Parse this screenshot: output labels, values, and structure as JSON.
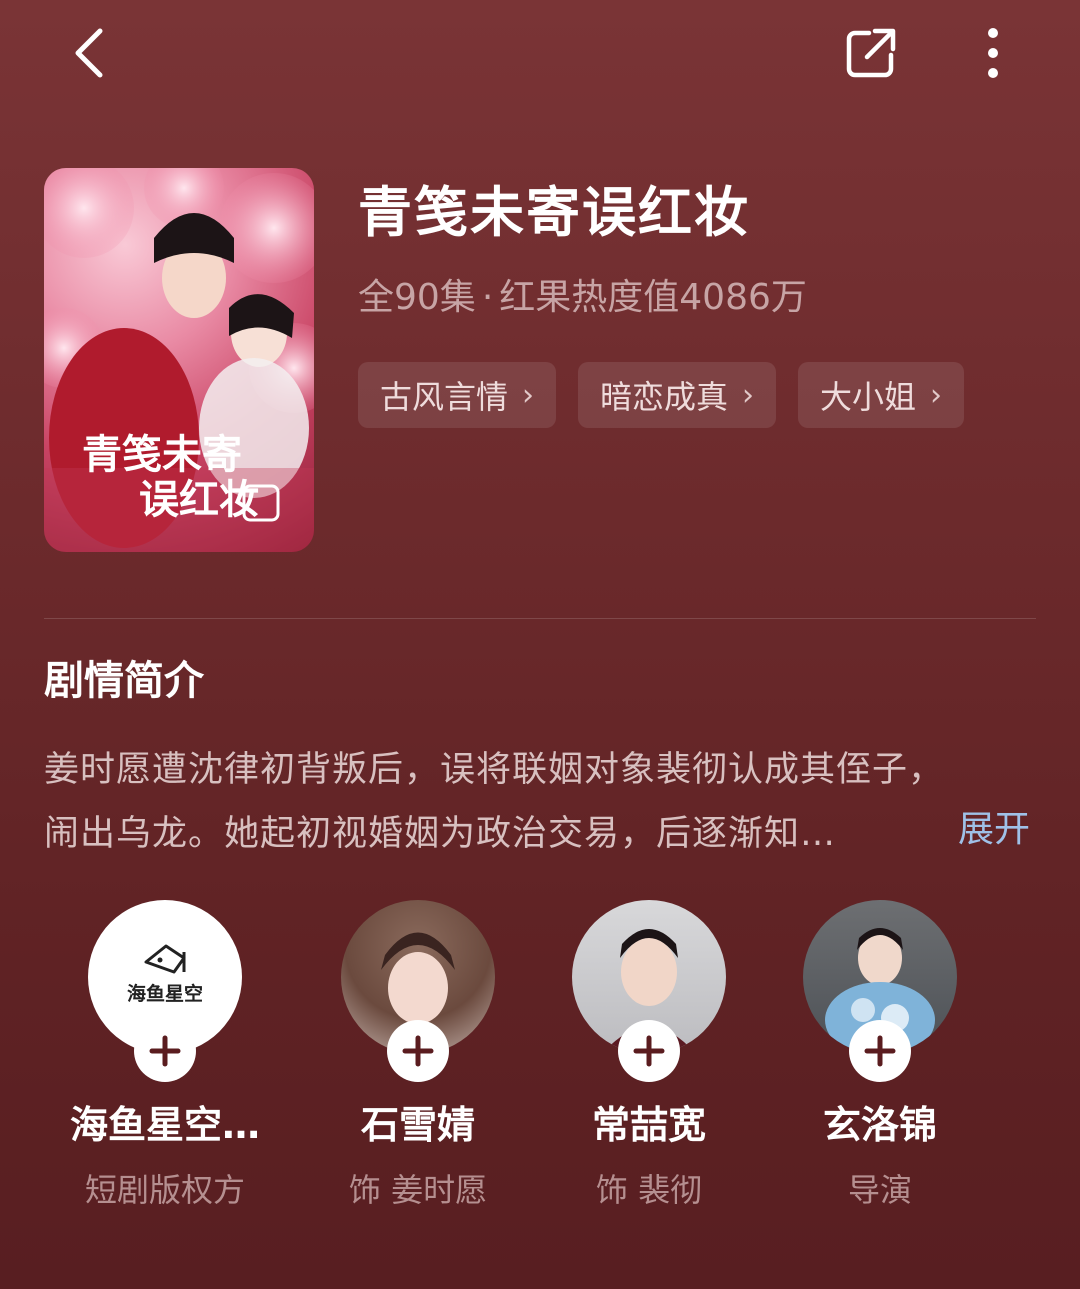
{
  "header": {
    "back_icon": "back-arrow-icon",
    "share_icon": "share-icon",
    "more_icon": "more-vertical-icon"
  },
  "drama": {
    "title": "青笺未寄误红妆",
    "episodes": "全90集",
    "separator": "·",
    "heat": "红果热度值4086万",
    "poster_title_lines": [
      "青笺未寄",
      "误红妆"
    ],
    "tags": [
      "古风言情",
      "暗恋成真",
      "大小姐"
    ]
  },
  "synopsis": {
    "heading": "剧情简介",
    "line1": "姜时愿遭沈律初背叛后，误将联姻对象裴彻认成其侄子，",
    "line2": "闹出乌龙。她起初视婚姻为政治交易，后逐渐知…",
    "expand_label": "展开"
  },
  "cast": [
    {
      "name": "海鱼星空…",
      "role": "短剧版权方",
      "logo_text": "海鱼星空"
    },
    {
      "name": "石雪婧",
      "role": "饰 姜时愿"
    },
    {
      "name": "常喆宽",
      "role": "饰 裴彻"
    },
    {
      "name": "玄洛锦",
      "role": "导演"
    }
  ],
  "colors": {
    "background": "#6c2a2c",
    "expand_link": "#9fc1e8",
    "muted_text": "#c7a4a5"
  }
}
